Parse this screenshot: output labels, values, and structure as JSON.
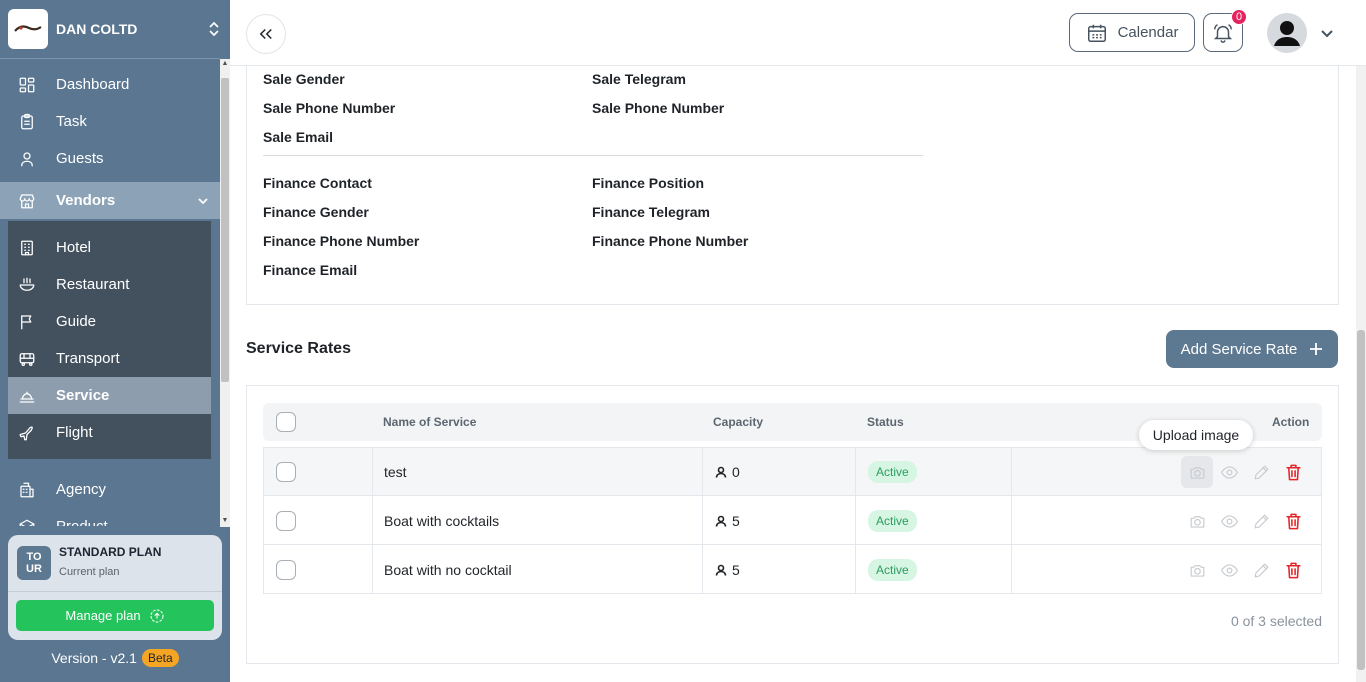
{
  "sidebar": {
    "brand_name": "DAN COLTD",
    "nav": [
      {
        "label": "Dashboard",
        "icon": "dashboard-icon"
      },
      {
        "label": "Task",
        "icon": "clipboard-icon"
      },
      {
        "label": "Guests",
        "icon": "user-icon"
      }
    ],
    "vendors_label": "Vendors",
    "vendor_items": [
      {
        "label": "Hotel",
        "icon": "building-icon"
      },
      {
        "label": "Restaurant",
        "icon": "dining-icon"
      },
      {
        "label": "Guide",
        "icon": "flag-icon"
      },
      {
        "label": "Transport",
        "icon": "bus-icon"
      },
      {
        "label": "Service",
        "icon": "service-icon",
        "active": true
      },
      {
        "label": "Flight",
        "icon": "plane-icon"
      }
    ],
    "after_items": [
      {
        "label": "Agency",
        "icon": "agency-icon"
      },
      {
        "label": "Product",
        "icon": "box-icon"
      }
    ],
    "plan": {
      "icon_text_line1": "TO",
      "icon_text_line2": "UR",
      "name": "STANDARD PLAN",
      "subtitle": "Current plan",
      "manage_label": "Manage plan"
    },
    "version": "Version - v2.1",
    "beta": "Beta"
  },
  "topbar": {
    "calendar_label": "Calendar",
    "notification_count": "0"
  },
  "contacts": {
    "sale_gender": "Sale Gender",
    "sale_telegram": "Sale Telegram",
    "sale_phone_left": "Sale Phone Number",
    "sale_phone_right": "Sale Phone Number",
    "sale_email": "Sale Email",
    "finance_contact": "Finance Contact",
    "finance_position": "Finance Position",
    "finance_gender": "Finance Gender",
    "finance_telegram": "Finance Telegram",
    "finance_phone_left": "Finance Phone Number",
    "finance_phone_right": "Finance Phone Number",
    "finance_email": "Finance Email"
  },
  "service_rates": {
    "title": "Service Rates",
    "add_label": "Add Service Rate",
    "columns": {
      "name": "Name of Service",
      "capacity": "Capacity",
      "status": "Status",
      "action": "Action"
    },
    "rows": [
      {
        "name": "test",
        "capacity": "0",
        "status": "Active"
      },
      {
        "name": "Boat with cocktails",
        "capacity": "5",
        "status": "Active"
      },
      {
        "name": "Boat with no cocktail",
        "capacity": "5",
        "status": "Active"
      }
    ],
    "tooltip": "Upload image",
    "selected_text": "0 of 3 selected"
  },
  "colors": {
    "sidebar": "#5a7690",
    "accent": "#5d7891",
    "active_status": "#2a9d5e",
    "delete": "#e5252a",
    "manage_button": "#24c35c",
    "badge": "#e5245f"
  }
}
